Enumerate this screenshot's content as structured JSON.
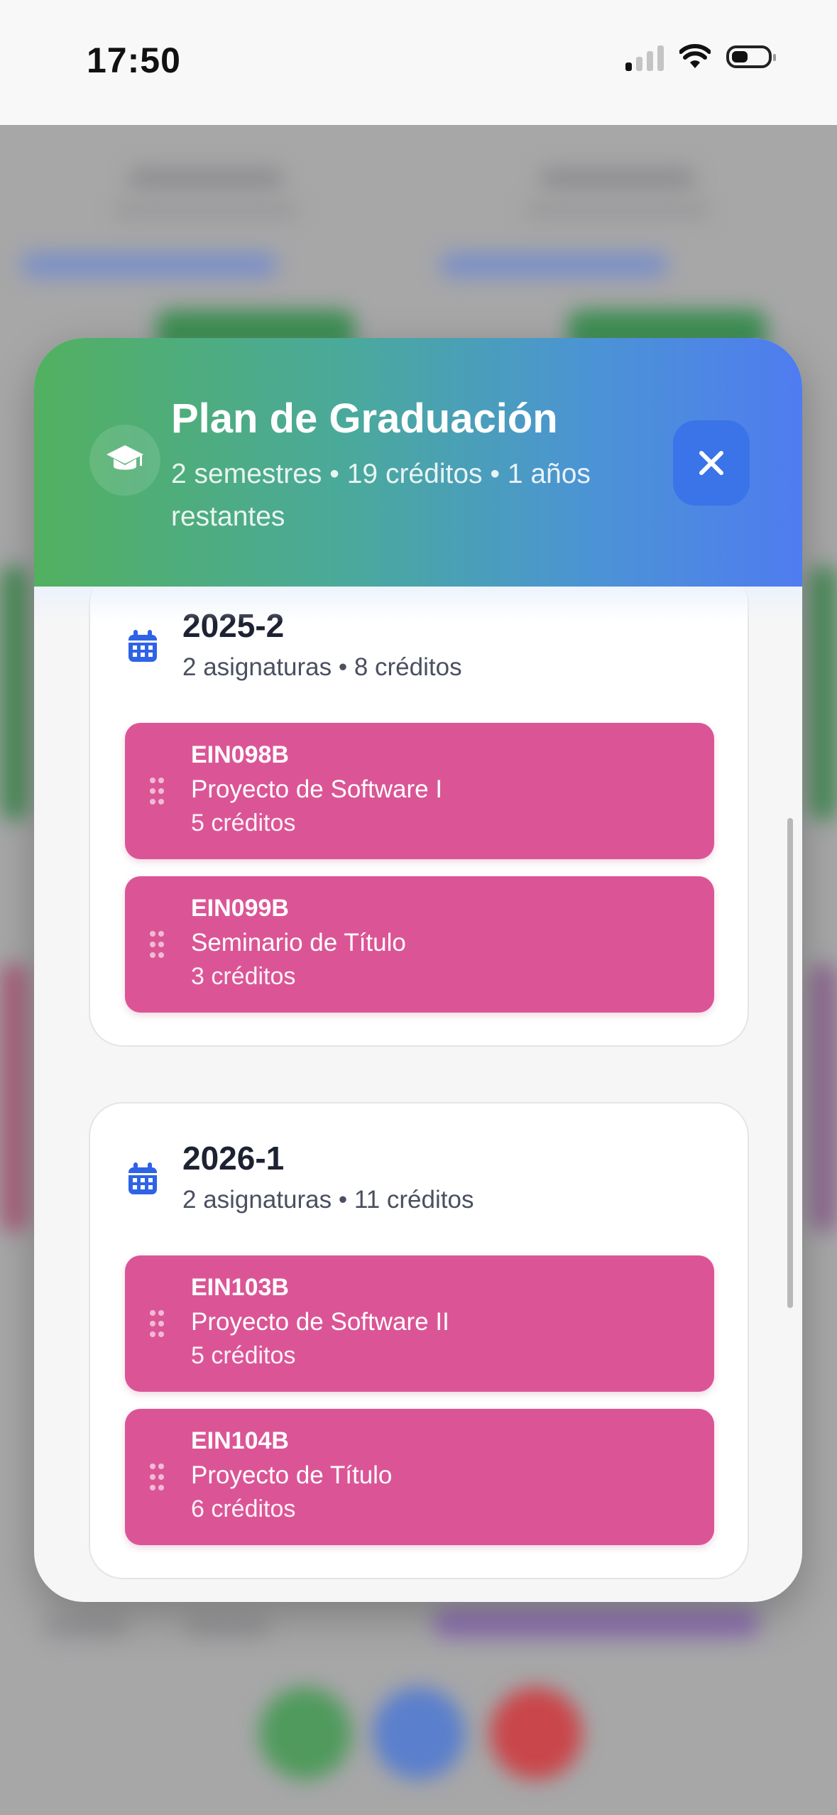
{
  "status_bar": {
    "time": "17:50"
  },
  "modal": {
    "title": "Plan de Graduación",
    "subtitle": "2 semestres • 19 créditos • 1 años restantes",
    "header_gradient": [
      "#52b060",
      "#4f7cf0"
    ],
    "icon": "graduation-cap-icon",
    "close_icon": "close-icon"
  },
  "semesters": [
    {
      "title": "2025-2",
      "meta": "2 asignaturas • 8 créditos",
      "courses": [
        {
          "code": "EIN098B",
          "name": "Proyecto de Software I",
          "credits": "5 créditos"
        },
        {
          "code": "EIN099B",
          "name": "Seminario de Título",
          "credits": "3 créditos"
        }
      ]
    },
    {
      "title": "2026-1",
      "meta": "2 asignaturas • 11 créditos",
      "courses": [
        {
          "code": "EIN103B",
          "name": "Proyecto de Software II",
          "credits": "5 créditos"
        },
        {
          "code": "EIN104B",
          "name": "Proyecto de Título",
          "credits": "6 créditos"
        }
      ]
    }
  ],
  "colors": {
    "course_card": "#db5596",
    "calendar_icon": "#2f63e6",
    "close_button": "#3a74e8"
  }
}
